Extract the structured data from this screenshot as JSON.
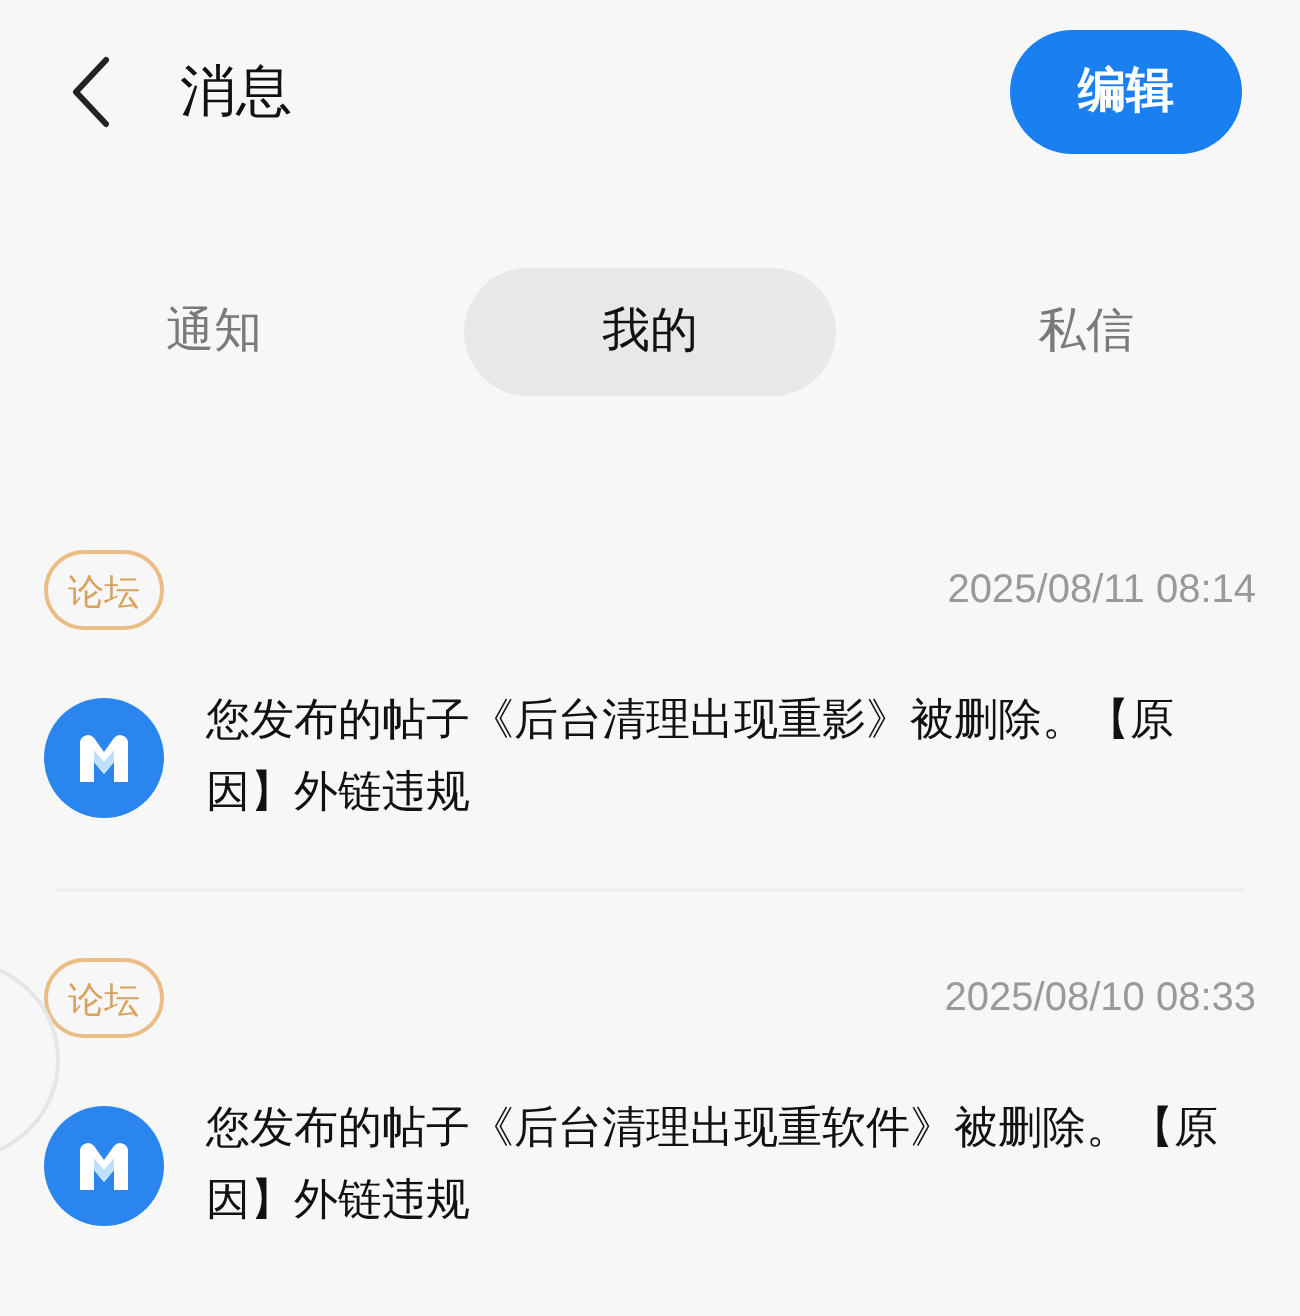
{
  "header": {
    "title": "消息",
    "edit_button": "编辑"
  },
  "tabs": [
    {
      "label": "通知",
      "selected": false
    },
    {
      "label": "我的",
      "selected": true
    },
    {
      "label": "私信",
      "selected": false
    }
  ],
  "messages": [
    {
      "tag": "论坛",
      "time": "2025/08/11 08:14",
      "text": "您发布的帖子《后台清理出现重影》被删除。【原因】外链违规"
    },
    {
      "tag": "论坛",
      "time": "2025/08/10 08:33",
      "text": "您发布的帖子《后台清理出现重软件》被删除。【原因】外链违规"
    }
  ]
}
